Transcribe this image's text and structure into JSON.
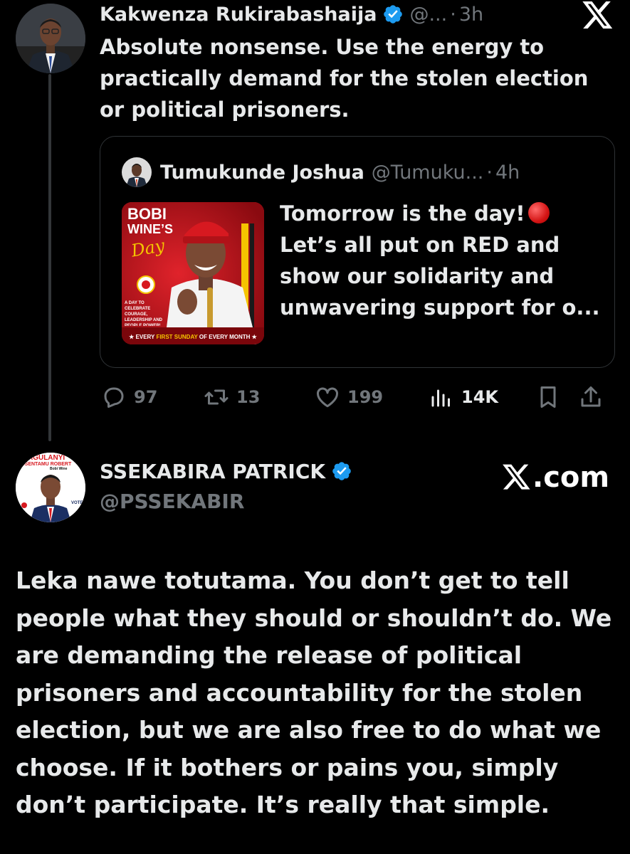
{
  "quoted_reply": {
    "author_name": "Kakwenza Rukirabashaija",
    "handle": "@...",
    "separator": "·",
    "time": "3h",
    "text": "Absolute nonsense. Use the energy to practically demand for the stolen election or political prisoners.",
    "quote": {
      "author_name": "Tumukunde Joshua",
      "handle": "@Tumuku...",
      "separator": "·",
      "time": "4h",
      "text": "Tomorrow is the day!",
      "text_rest": "Let’s all put on RED and show our solidarity and unwavering support for o...",
      "media": {
        "headline_1": "BOBI",
        "headline_2": "WINE’S",
        "headline_3": "Day",
        "caption": "A DAY TO CELEBRATE COURAGE, LEADERSHIP AND PEOPLE POWER!",
        "footer_a": "★ EVERY ",
        "footer_b": "FIRST SUNDAY",
        "footer_c": " OF EVERY MONTH ★"
      }
    },
    "stats": {
      "replies": "97",
      "retweets": "13",
      "likes": "199",
      "views": "14K"
    }
  },
  "main_tweet": {
    "author_name": "SSEKABIRA PATRICK",
    "handle": "@PSSEKABIR",
    "avatar_banner_1": "KYAGULANYI",
    "avatar_banner_2": "SSENTAMU ROBERT",
    "avatar_banner_3": "Bobi Wine",
    "avatar_side": "VOTE",
    "text": "Leka nawe totutama. You don’t get to tell people what they should or shouldn’t do. We are demanding the release of political prisoners and accountability for the stolen election, but we are also free to do what we choose. If it bothers or pains you, simply don’t participate. It’s really that simple."
  },
  "watermark": {
    "text": ".com"
  },
  "colors": {
    "background": "#000000",
    "text": "#e7e9ea",
    "muted": "#71767b",
    "verified_blue": "#1d9bf0",
    "accent_red": "#b5121b"
  },
  "icons": [
    "x-logo-icon",
    "verified-icon",
    "reply-icon",
    "retweet-icon",
    "like-icon",
    "views-icon",
    "bookmark-icon",
    "share-icon"
  ]
}
